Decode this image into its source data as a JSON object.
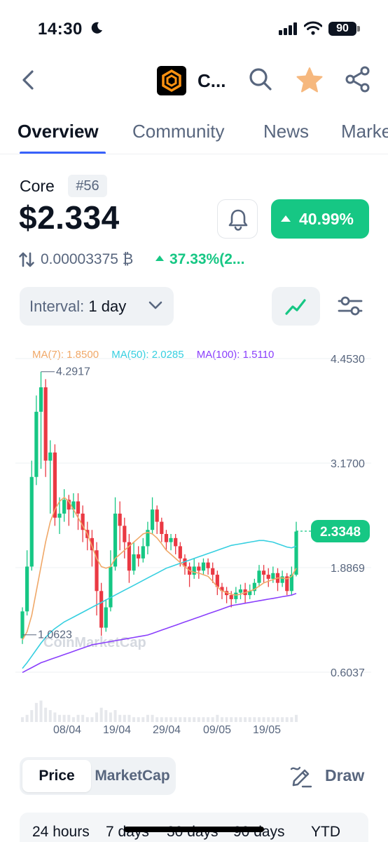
{
  "status_bar": {
    "time": "14:30",
    "battery": "90"
  },
  "header": {
    "coin_short": "C..."
  },
  "tabs": [
    {
      "label": "Overview"
    },
    {
      "label": "Community"
    },
    {
      "label": "News"
    },
    {
      "label": "Marke"
    }
  ],
  "coin": {
    "name": "Core",
    "rank": "#56",
    "price": "$2.334",
    "change_24h": "40.99%",
    "btc_price": "0.00003375 ₿",
    "btc_change": "37.33%(2..."
  },
  "colors": {
    "accent": "#3861fb",
    "up": "#16c784",
    "down": "#ea3943",
    "ma7": "#f0a868",
    "ma50": "#36cfe0",
    "ma100": "#8a3ffc"
  },
  "controls": {
    "interval_label": "Interval:",
    "interval_value": "1 day",
    "price_tab": "Price",
    "marketcap_tab": "MarketCap",
    "draw_label": "Draw"
  },
  "chart_data": {
    "type": "candlestick",
    "legend": [
      {
        "label": "MA(7): 1.8500",
        "color": "#f0a868"
      },
      {
        "label": "MA(50): 2.0285",
        "color": "#36cfe0"
      },
      {
        "label": "MA(100): 1.5110",
        "color": "#8a3ffc"
      }
    ],
    "y_axis_ticks": [
      "4.4530",
      "3.1700",
      "1.8869",
      "0.6037"
    ],
    "y_ticks_values": [
      4.453,
      3.17,
      1.8869,
      0.6037
    ],
    "ylim": [
      0.6037,
      4.453
    ],
    "x_axis_ticks": [
      "08/04",
      "19/04",
      "29/04",
      "09/05",
      "19/05"
    ],
    "max_label": "4.2917",
    "min_label": "1.0623",
    "current_price_label": "2.3348",
    "current_price": 2.3348,
    "watermark": "CoinMarketCap",
    "candles": [
      [
        1.02,
        1.35,
        0.95,
        1.4
      ],
      [
        1.35,
        1.9,
        1.3,
        2.1
      ],
      [
        1.9,
        3.0,
        1.85,
        3.2
      ],
      [
        3.0,
        3.8,
        2.9,
        4.0
      ],
      [
        3.8,
        4.1,
        3.1,
        4.29
      ],
      [
        4.1,
        3.2,
        3.0,
        4.2
      ],
      [
        3.2,
        3.3,
        2.55,
        3.45
      ],
      [
        3.3,
        2.5,
        2.4,
        3.4
      ],
      [
        2.5,
        2.55,
        2.3,
        2.75
      ],
      [
        2.55,
        2.72,
        2.45,
        2.85
      ],
      [
        2.72,
        2.6,
        2.4,
        2.78
      ],
      [
        2.6,
        2.7,
        2.5,
        2.8
      ],
      [
        2.7,
        2.55,
        2.35,
        2.8
      ],
      [
        2.55,
        2.35,
        2.2,
        2.65
      ],
      [
        2.35,
        2.25,
        2.1,
        2.45
      ],
      [
        2.25,
        2.1,
        1.9,
        2.35
      ],
      [
        2.1,
        1.6,
        1.3,
        2.2
      ],
      [
        1.6,
        1.15,
        1.05,
        1.7
      ],
      [
        1.15,
        1.4,
        1.1,
        1.5
      ],
      [
        1.4,
        1.9,
        1.35,
        2.1
      ],
      [
        1.9,
        2.55,
        1.85,
        2.75
      ],
      [
        2.55,
        2.4,
        2.1,
        2.7
      ],
      [
        2.4,
        2.2,
        2.0,
        2.5
      ],
      [
        2.2,
        1.85,
        1.7,
        2.3
      ],
      [
        1.85,
        2.05,
        1.8,
        2.2
      ],
      [
        2.05,
        2.0,
        1.9,
        2.15
      ],
      [
        2.0,
        2.15,
        1.95,
        2.25
      ],
      [
        2.15,
        2.35,
        2.05,
        2.45
      ],
      [
        2.35,
        2.6,
        2.3,
        2.75
      ],
      [
        2.6,
        2.45,
        2.3,
        2.65
      ],
      [
        2.45,
        2.3,
        2.2,
        2.5
      ],
      [
        2.3,
        2.2,
        2.1,
        2.35
      ],
      [
        2.2,
        2.25,
        2.1,
        2.3
      ],
      [
        2.25,
        2.15,
        2.05,
        2.3
      ],
      [
        2.15,
        2.0,
        1.9,
        2.2
      ],
      [
        2.0,
        1.9,
        1.8,
        2.05
      ],
      [
        1.9,
        1.8,
        1.65,
        1.95
      ],
      [
        1.8,
        1.9,
        1.75,
        2.0
      ],
      [
        1.9,
        1.85,
        1.75,
        1.95
      ],
      [
        1.85,
        1.95,
        1.8,
        2.0
      ],
      [
        1.95,
        1.88,
        1.8,
        2.0
      ],
      [
        1.88,
        1.8,
        1.7,
        1.95
      ],
      [
        1.8,
        1.65,
        1.55,
        1.85
      ],
      [
        1.65,
        1.6,
        1.5,
        1.7
      ],
      [
        1.6,
        1.55,
        1.45,
        1.65
      ],
      [
        1.55,
        1.5,
        1.4,
        1.6
      ],
      [
        1.5,
        1.58,
        1.45,
        1.65
      ],
      [
        1.58,
        1.62,
        1.5,
        1.68
      ],
      [
        1.62,
        1.55,
        1.45,
        1.7
      ],
      [
        1.55,
        1.6,
        1.5,
        1.68
      ],
      [
        1.6,
        1.7,
        1.55,
        1.75
      ],
      [
        1.7,
        1.85,
        1.65,
        1.92
      ],
      [
        1.85,
        1.8,
        1.7,
        1.92
      ],
      [
        1.8,
        1.75,
        1.65,
        1.88
      ],
      [
        1.75,
        1.82,
        1.7,
        1.9
      ],
      [
        1.82,
        1.7,
        1.6,
        1.88
      ],
      [
        1.7,
        1.78,
        1.65,
        1.85
      ],
      [
        1.78,
        1.6,
        1.55,
        1.82
      ],
      [
        1.6,
        1.8,
        1.55,
        1.9
      ],
      [
        1.8,
        2.33,
        1.78,
        2.45
      ]
    ],
    "ma7": [
      1.0,
      1.1,
      1.3,
      1.6,
      1.9,
      2.2,
      2.45,
      2.6,
      2.7,
      2.75,
      2.7,
      2.6,
      2.5,
      2.4,
      2.3,
      2.15,
      2.0,
      1.9,
      1.88,
      1.9,
      2.0,
      2.05,
      2.1,
      2.15,
      2.2,
      2.25,
      2.3,
      2.32,
      2.3,
      2.25,
      2.18,
      2.1,
      2.05,
      2.0,
      1.95,
      1.9,
      1.85,
      1.83,
      1.82,
      1.8,
      1.78,
      1.72,
      1.65,
      1.6,
      1.58,
      1.56,
      1.55,
      1.56,
      1.58,
      1.6,
      1.62,
      1.66,
      1.7,
      1.72,
      1.74,
      1.76,
      1.76,
      1.75,
      1.78,
      1.88
    ],
    "ma50": [
      0.65,
      0.72,
      0.8,
      0.88,
      0.96,
      1.03,
      1.09,
      1.14,
      1.18,
      1.22,
      1.25,
      1.28,
      1.31,
      1.34,
      1.37,
      1.4,
      1.43,
      1.46,
      1.49,
      1.52,
      1.55,
      1.58,
      1.61,
      1.64,
      1.67,
      1.7,
      1.73,
      1.76,
      1.79,
      1.82,
      1.85,
      1.88,
      1.9,
      1.92,
      1.94,
      1.96,
      1.98,
      2.0,
      2.02,
      2.04,
      2.06,
      2.08,
      2.1,
      2.12,
      2.14,
      2.16,
      2.17,
      2.18,
      2.19,
      2.2,
      2.21,
      2.22,
      2.22,
      2.21,
      2.2,
      2.18,
      2.16,
      2.14,
      2.13,
      2.15
    ],
    "ma100": [
      0.6,
      0.63,
      0.66,
      0.69,
      0.72,
      0.74,
      0.76,
      0.78,
      0.8,
      0.82,
      0.84,
      0.86,
      0.88,
      0.9,
      0.92,
      0.94,
      0.95,
      0.96,
      0.97,
      0.98,
      0.99,
      1.0,
      1.01,
      1.02,
      1.03,
      1.04,
      1.05,
      1.06,
      1.08,
      1.1,
      1.12,
      1.14,
      1.16,
      1.18,
      1.2,
      1.22,
      1.24,
      1.26,
      1.28,
      1.3,
      1.32,
      1.34,
      1.36,
      1.38,
      1.4,
      1.42,
      1.43,
      1.44,
      1.45,
      1.46,
      1.47,
      1.48,
      1.49,
      1.5,
      1.51,
      1.52,
      1.53,
      1.54,
      1.55,
      1.57
    ],
    "volume": [
      2,
      3,
      5,
      8,
      9,
      6,
      5,
      4,
      3,
      3,
      3,
      2,
      3,
      3,
      2,
      2,
      4,
      6,
      5,
      4,
      5,
      3,
      3,
      3,
      2,
      2,
      2,
      3,
      3,
      2,
      2,
      2,
      2,
      2,
      2,
      2,
      2,
      2,
      2,
      2,
      2,
      2,
      3,
      2,
      2,
      2,
      2,
      2,
      2,
      2,
      2,
      2,
      2,
      2,
      2,
      2,
      2,
      2,
      2,
      3
    ]
  },
  "time_ranges": [
    "24 hours",
    "7 days",
    "30 days",
    "90 days",
    "YTD"
  ]
}
